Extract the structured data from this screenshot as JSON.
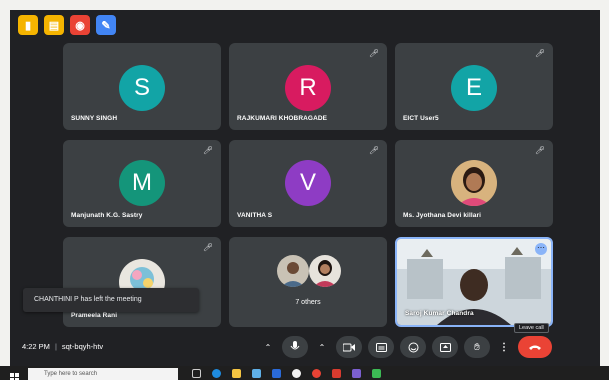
{
  "extensions": [
    {
      "icon": "folder-icon",
      "color": "#f5b400"
    },
    {
      "icon": "document-icon",
      "color": "#f5b400"
    },
    {
      "icon": "record-icon",
      "color": "#ea4335"
    },
    {
      "icon": "edit-icon",
      "color": "#4285f4"
    }
  ],
  "participants": [
    {
      "name": "SUNNY SINGH",
      "initial": "S",
      "avatar_color": "#12a4a6",
      "muted": false
    },
    {
      "name": "RAJKUMARI KHOBRAGADE",
      "initial": "R",
      "avatar_color": "#d81b60",
      "muted": true
    },
    {
      "name": "EICT User5",
      "initial": "E",
      "avatar_color": "#12a4a6",
      "muted": true
    },
    {
      "name": "Manjunath K.G. Sastry",
      "initial": "M",
      "avatar_color": "#14957a",
      "muted": true
    },
    {
      "name": "VANITHA S",
      "initial": "V",
      "avatar_color": "#8e3cc4",
      "muted": true
    },
    {
      "name": "Ms. Jyothana Devi killari",
      "muted": true
    },
    {
      "name": "Prameela Rani",
      "muted": true
    },
    {
      "name": "7 others"
    },
    {
      "name": "Saroj Kumar Chandra"
    }
  ],
  "toast": "CHANTHINI P has left the meeting",
  "meeting": {
    "time": "4:22 PM",
    "separator": "|",
    "code": "sqt-bqyh-htv"
  },
  "controls": {
    "leave_tooltip": "Leave call"
  },
  "taskbar": {
    "search_placeholder": "Type here to search"
  }
}
